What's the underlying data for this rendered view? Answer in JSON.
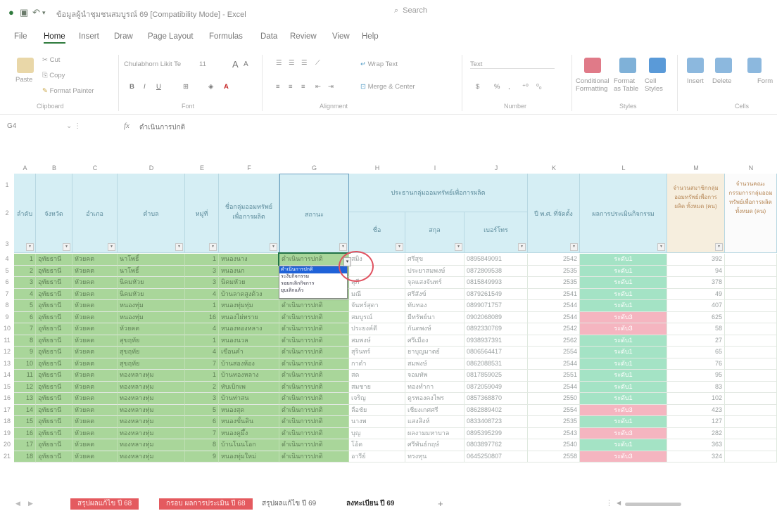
{
  "title_bar": {
    "title": "ข้อมูลผู้นำชุมชนสมบูรณ์ 69 [Compatibility Mode] - Excel",
    "search": "Search"
  },
  "menu": [
    "File",
    "Home",
    "Insert",
    "Draw",
    "Page Layout",
    "Formulas",
    "Data",
    "Review",
    "View",
    "Help"
  ],
  "ribbon": {
    "paste": "Paste",
    "cut": "Cut",
    "copy": "Copy",
    "format_painter": "Format Painter",
    "font_name": "Chulabhorn Likit Te",
    "font_size": "11",
    "wrap_text": "Wrap Text",
    "merge_center": "Merge & Center",
    "number_format": "Text",
    "conditional_formatting": "Conditional Formatting",
    "format_as_table": "Format as Table",
    "cell_styles": "Cell Styles",
    "insert": "Insert",
    "delete": "Delete",
    "format": "Form",
    "groups": {
      "clipboard": "Clipboard",
      "font": "Font",
      "alignment": "Alignment",
      "number": "Number",
      "styles": "Styles",
      "cells": "Cells"
    }
  },
  "formula_bar": {
    "name_box": "G4",
    "fx": "fx",
    "content": "ดำเนินการปกติ"
  },
  "columns": [
    "A",
    "B",
    "C",
    "D",
    "E",
    "F",
    "G",
    "H",
    "I",
    "J",
    "K",
    "L",
    "M",
    "N"
  ],
  "headers": {
    "A": "ลำดับ",
    "B": "จังหวัด",
    "C": "อำเภอ",
    "D": "ตำบล",
    "E": "หมู่ที่",
    "F": "ชื่อกลุ่มออมทรัพย์เพื่อการผลิต",
    "G": "สถานะ",
    "HJ": "ประธานกลุ่มออมทรัพย์เพื่อการผลิต",
    "H": "ชื่อ",
    "I": "สกุล",
    "J": "เบอร์โทร",
    "K": "ปี พ.ศ. ที่จัดตั้ง",
    "L": "ผลการประเมินกิจกรรม",
    "M": "จำนวนสมาชิกกลุ่มออมทรัพย์เพื่อการผลิต ทั้งหมด (คน)",
    "N": "จำนวนคณะกรรมการกลุ่มออมทรัพย์เพื่อการผลิต ทั้งหมด (คน)"
  },
  "rows": [
    {
      "n": "1",
      "b": "อุทัยธานี",
      "c": "หัวยคต",
      "d": "นาโพธิ์",
      "e": "1",
      "f": "หนองนาง",
      "g": "ดำเนินการปกติ",
      "h": "สมิง",
      "i": "ศรีสุข",
      "j": "0895849091",
      "k": "2542",
      "l": "ระดับ1",
      "l_bad": false,
      "m": "392"
    },
    {
      "n": "2",
      "b": "อุทัยธานี",
      "c": "หัวยคต",
      "d": "นาโพธิ์",
      "e": "3",
      "f": "หนองนก",
      "g": "ดำเนินการปกติ",
      "h": "",
      "i": "ประยาสมพงษ์",
      "j": "0872809538",
      "k": "2535",
      "l": "ระดับ1",
      "l_bad": false,
      "m": "94"
    },
    {
      "n": "3",
      "b": "อุทัยธานี",
      "c": "หัวยคต",
      "d": "นิคมหัวย",
      "e": "3",
      "f": "นิคมหัวย",
      "g": "ดำเนินการปกติ",
      "h": "สุภี",
      "i": "จุลแสงจันทร์",
      "j": "0815849993",
      "k": "2535",
      "l": "ระดับ1",
      "l_bad": false,
      "m": "378"
    },
    {
      "n": "4",
      "b": "อุทัยธานี",
      "c": "หัวยคต",
      "d": "นิคมหัวย",
      "e": "4",
      "f": "บ้านลาดสูงด้วง",
      "g": "ดำเนินการปกติ",
      "h": "มณี",
      "i": "ศรีสังข์",
      "j": "0879261549",
      "k": "2541",
      "l": "ระดับ1",
      "l_bad": false,
      "m": "49"
    },
    {
      "n": "5",
      "b": "อุทัยธานี",
      "c": "หัวยคต",
      "d": "หนองทุ่ม",
      "e": "1",
      "f": "หนองทุ่มทุ่ม",
      "g": "ดำเนินการปกติ",
      "h": "จันทร์สุดา",
      "i": "ทับทอง",
      "j": "0899071757",
      "k": "2544",
      "l": "ระดับ1",
      "l_bad": false,
      "m": "407"
    },
    {
      "n": "6",
      "b": "อุทัยธานี",
      "c": "หัวยคต",
      "d": "หนองทุ่ม",
      "e": "16",
      "f": "หนองไผ่ทราย",
      "g": "ดำเนินการปกติ",
      "h": "สมบูรณ์",
      "i": "มีทรัพย์นา",
      "j": "0902068089",
      "k": "2544",
      "l": "ระดับ3",
      "l_bad": true,
      "m": "625"
    },
    {
      "n": "7",
      "b": "อุทัยธานี",
      "c": "หัวยคต",
      "d": "หัวยคต",
      "e": "4",
      "f": "หนองทองหลาง",
      "g": "ดำเนินการปกติ",
      "h": "ประยงค์ดี",
      "i": "กันตพงษ์",
      "j": "0892330769",
      "k": "2542",
      "l": "ระดับ3",
      "l_bad": true,
      "m": "58"
    },
    {
      "n": "8",
      "b": "อุทัยธานี",
      "c": "หัวยคต",
      "d": "สุขฤทัย",
      "e": "1",
      "f": "หนองนวล",
      "g": "ดำเนินการปกติ",
      "h": "สมพงษ์",
      "i": "ศรีเมือง",
      "j": "0938937391",
      "k": "2562",
      "l": "ระดับ1",
      "l_bad": false,
      "m": "27"
    },
    {
      "n": "9",
      "b": "อุทัยธานี",
      "c": "หัวยคต",
      "d": "สุขฤทัย",
      "e": "4",
      "f": "เขือนคำ",
      "g": "ดำเนินการปกติ",
      "h": "สุรินทร์",
      "i": "ยาบุญมาตย์",
      "j": "0806564417",
      "k": "2554",
      "l": "ระดับ1",
      "l_bad": false,
      "m": "65"
    },
    {
      "n": "10",
      "b": "อุทัยธานี",
      "c": "หัวยคต",
      "d": "สุขฤทัย",
      "e": "7",
      "f": "บ้านสองห้อง",
      "g": "ดำเนินการปกติ",
      "h": "กาดำ",
      "i": "สมพงษ์",
      "j": "0862088531",
      "k": "2544",
      "l": "ระดับ1",
      "l_bad": false,
      "m": "76"
    },
    {
      "n": "11",
      "b": "อุทัยธานี",
      "c": "หัวยคต",
      "d": "ทองหลางทุ่ม",
      "e": "1",
      "f": "บ้านทองหลาง",
      "g": "ดำเนินการปกติ",
      "h": "สด",
      "i": "จอมทัพ",
      "j": "0817859025",
      "k": "2551",
      "l": "ระดับ1",
      "l_bad": false,
      "m": "95"
    },
    {
      "n": "12",
      "b": "อุทัยธานี",
      "c": "หัวยคต",
      "d": "ทองหลางทุ่ม",
      "e": "2",
      "f": "ทับเบิกเพ",
      "g": "ดำเนินการปกติ",
      "h": "สมชาย",
      "i": "ทองทำกา",
      "j": "0872059049",
      "k": "2544",
      "l": "ระดับ1",
      "l_bad": false,
      "m": "83"
    },
    {
      "n": "13",
      "b": "อุทัยธานี",
      "c": "หัวยคต",
      "d": "ทองหลางทุ่ม",
      "e": "3",
      "f": "บ้านท่าสน",
      "g": "ดำเนินการปกติ",
      "h": "เจริญ",
      "i": "ดูรทองคงไพร",
      "j": "0857368870",
      "k": "2550",
      "l": "ระดับ1",
      "l_bad": false,
      "m": "102"
    },
    {
      "n": "14",
      "b": "อุทัยธานี",
      "c": "หัวยคต",
      "d": "ทองหลางทุ่ม",
      "e": "5",
      "f": "หนองสุด",
      "g": "ดำเนินการปกติ",
      "h": "ลือชัย",
      "i": "เชียงเกศศรี",
      "j": "0862889402",
      "k": "2554",
      "l": "ระดับ3",
      "l_bad": true,
      "m": "423"
    },
    {
      "n": "15",
      "b": "อุทัยธานี",
      "c": "หัวยคต",
      "d": "ทองหลางทุ่ม",
      "e": "6",
      "f": "หนองขั้นดิน",
      "g": "ดำเนินการปกติ",
      "h": "นางพ",
      "i": "แสงสิงห์",
      "j": "0833408723",
      "k": "2535",
      "l": "ระดับ1",
      "l_bad": false,
      "m": "127"
    },
    {
      "n": "16",
      "b": "อุทัยธานี",
      "c": "หัวยคต",
      "d": "ทองหลางทุ่ม",
      "e": "7",
      "f": "หนองคูมึ้ง",
      "g": "ดำเนินการปกติ",
      "h": "บุญ",
      "i": "ผลงามมหาบาล",
      "j": "0895395299",
      "k": "2543",
      "l": "ระดับ3",
      "l_bad": true,
      "m": "282"
    },
    {
      "n": "17",
      "b": "อุทัยธานี",
      "c": "หัวยคต",
      "d": "ทองหลางทุ่ม",
      "e": "8",
      "f": "บ้านโนนโอก",
      "g": "ดำเนินการปกติ",
      "h": "โอ้ด",
      "i": "ศรีพันธ์กฤษ์",
      "j": "0803897762",
      "k": "2540",
      "l": "ระดับ1",
      "l_bad": false,
      "m": "363"
    },
    {
      "n": "18",
      "b": "อุทัยธานี",
      "c": "หัวยคต",
      "d": "ทองหลางทุ่ม",
      "e": "9",
      "f": "หนองทุ่มใหม่",
      "g": "ดำเนินการปกติ",
      "h": "อารีย์",
      "i": "ทรงทุน",
      "j": "0645250807",
      "k": "2558",
      "l": "ระดับ3",
      "l_bad": true,
      "m": "324"
    }
  ],
  "dropdown_options": [
    "ดำเนินการปกติ",
    "ระงับกิจกรรม",
    "รอยกเลิกกิจการ",
    "ยุบเลิกแล้ว"
  ],
  "sheet_tabs": [
    {
      "label": "สรุปผลแก้ไข ปี 68",
      "style": "red"
    },
    {
      "label": "กรอบ ผลการประเมิน ปี 68",
      "style": "red"
    },
    {
      "label": "สรุปผลแก้ไข ปี 69",
      "style": "plain"
    },
    {
      "label": "ลงทะเบียน ปี 69",
      "style": "bold"
    }
  ],
  "add_sheet": "+"
}
